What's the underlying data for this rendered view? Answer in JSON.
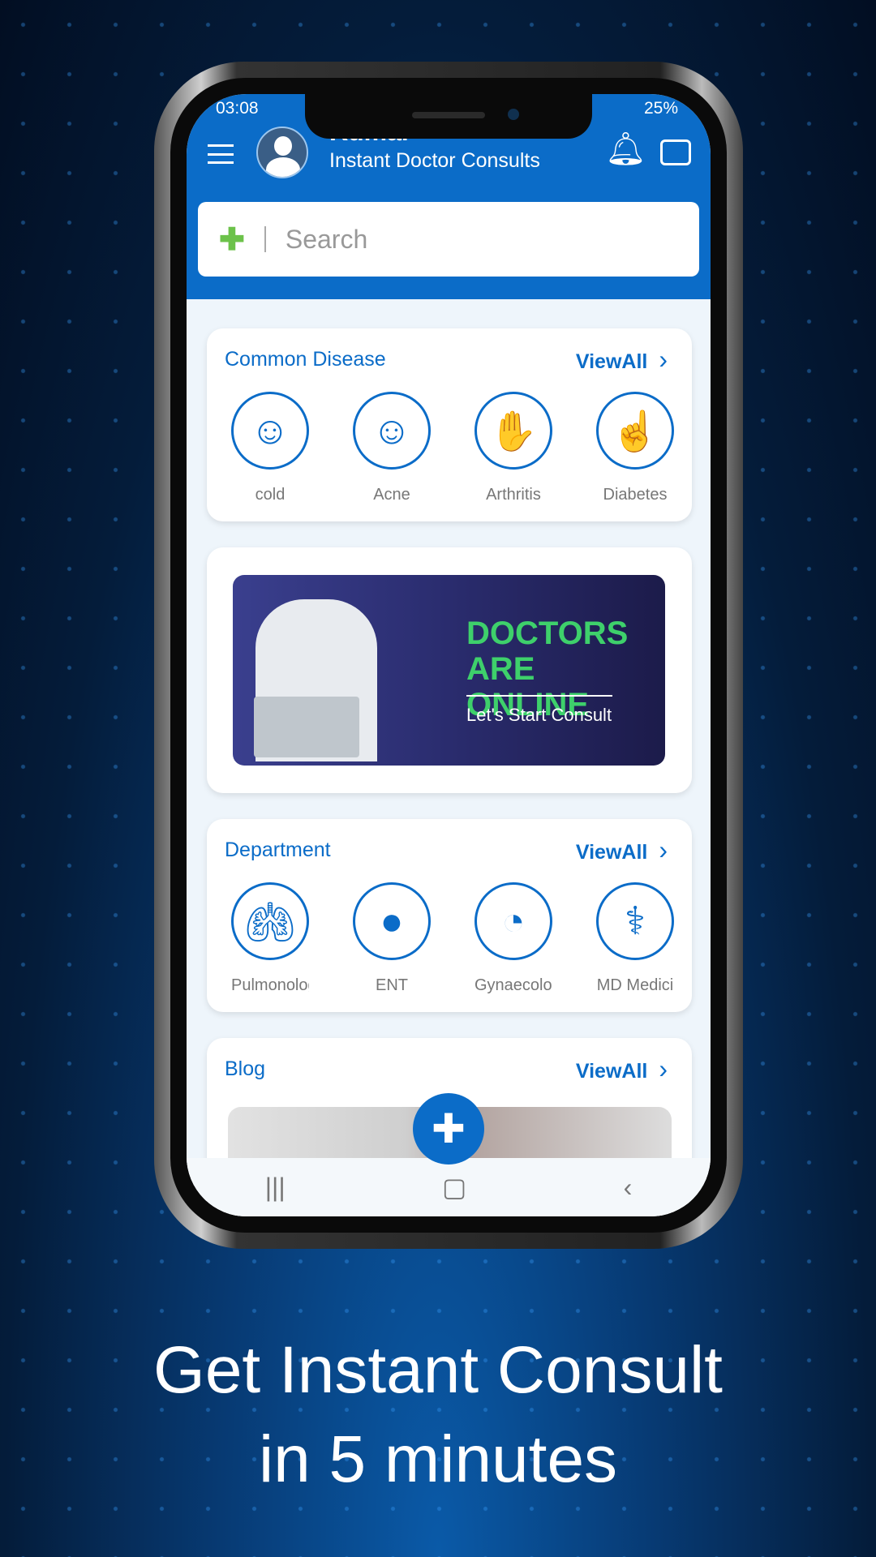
{
  "status": {
    "time": "03:08",
    "battery": "25%"
  },
  "header": {
    "user_name": "Kumar",
    "subtitle": "Instant Doctor Consults"
  },
  "search": {
    "placeholder": "Search"
  },
  "common_disease": {
    "title": "Common Disease",
    "view_all": "ViewAll",
    "items": [
      {
        "label": "cold",
        "icon": "face-virus-icon"
      },
      {
        "label": "Acne",
        "icon": "face-virus-icon"
      },
      {
        "label": "Arthritis",
        "icon": "hand-bones-icon"
      },
      {
        "label": "Diabetes",
        "icon": "glucose-meter-icon"
      }
    ]
  },
  "banner": {
    "line1": "DOCTORS",
    "line2": "ARE ONLINE",
    "line3": "Let's Start Consult"
  },
  "department": {
    "title": "Department",
    "view_all": "ViewAll",
    "items": [
      {
        "label": "Pulmonolog",
        "icon": "lungs-icon"
      },
      {
        "label": "ENT",
        "icon": "head-profile-icon"
      },
      {
        "label": "Gynaecolog",
        "icon": "fetus-icon"
      },
      {
        "label": "MD Medici",
        "icon": "doctor-icon"
      }
    ]
  },
  "blog": {
    "title": "Blog",
    "view_all": "ViewAll"
  },
  "caption": {
    "line1": "Get Instant Consult",
    "line2": "in 5 minutes"
  },
  "colors": {
    "primary": "#0b6cc8",
    "accent_green": "#3ed06b"
  }
}
